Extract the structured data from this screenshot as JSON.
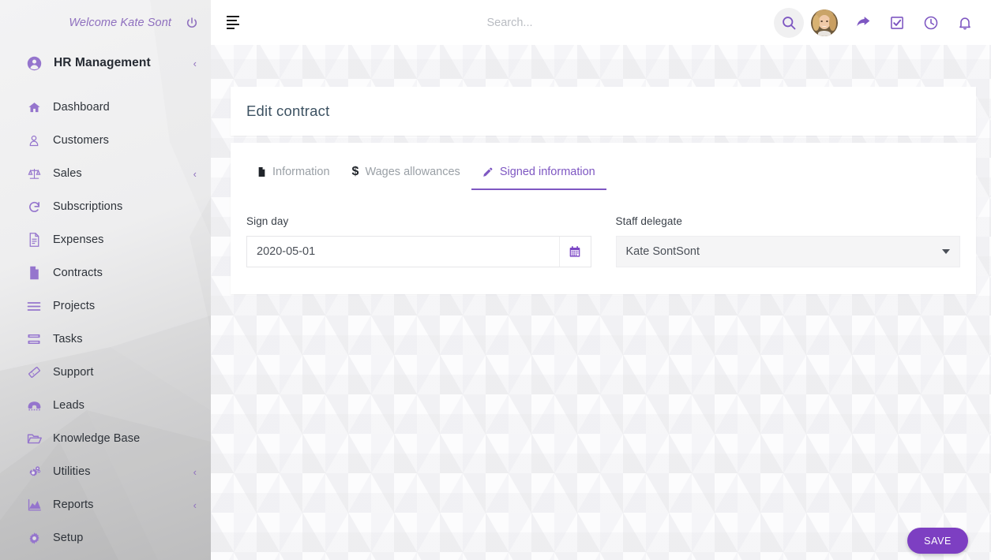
{
  "sidebar": {
    "welcome_text": "Welcome Kate Sont",
    "power_icon": "power-icon",
    "brand": {
      "label": "HR Management",
      "icon": "user-circle-icon",
      "chevron": "‹"
    },
    "items": [
      {
        "label": "Dashboard",
        "icon": "home-icon",
        "chevron": ""
      },
      {
        "label": "Customers",
        "icon": "user-icon",
        "chevron": ""
      },
      {
        "label": "Sales",
        "icon": "scales-icon",
        "chevron": "‹"
      },
      {
        "label": "Subscriptions",
        "icon": "refresh-icon",
        "chevron": ""
      },
      {
        "label": "Expenses",
        "icon": "file-lines-icon",
        "chevron": ""
      },
      {
        "label": "Contracts",
        "icon": "file-icon",
        "chevron": ""
      },
      {
        "label": "Projects",
        "icon": "list-icon",
        "chevron": ""
      },
      {
        "label": "Tasks",
        "icon": "tasks-icon",
        "chevron": ""
      },
      {
        "label": "Support",
        "icon": "ticket-icon",
        "chevron": ""
      },
      {
        "label": "Leads",
        "icon": "phone-icon",
        "chevron": ""
      },
      {
        "label": "Knowledge Base",
        "icon": "folder-open-icon",
        "chevron": ""
      },
      {
        "label": "Utilities",
        "icon": "gears-icon",
        "chevron": "‹"
      },
      {
        "label": "Reports",
        "icon": "chart-area-icon",
        "chevron": "‹"
      },
      {
        "label": "Setup",
        "icon": "gear-icon",
        "chevron": ""
      }
    ]
  },
  "topbar": {
    "menu_icon": "align-left-icon",
    "search_placeholder": "Search...",
    "search_value": "",
    "icons": [
      {
        "name": "search-icon"
      },
      {
        "name": "avatar"
      },
      {
        "name": "share-icon"
      },
      {
        "name": "check-square-icon"
      },
      {
        "name": "clock-icon"
      },
      {
        "name": "bell-icon"
      }
    ]
  },
  "page": {
    "title": "Edit contract",
    "tabs": [
      {
        "label": "Information",
        "icon": "file-icon",
        "active": false
      },
      {
        "label": "Wages allowances",
        "icon": "dollar-icon",
        "active": false
      },
      {
        "label": "Signed information",
        "icon": "pencil-icon",
        "active": true
      }
    ],
    "fields": {
      "sign_day": {
        "label": "Sign day",
        "value": "2020-05-01",
        "icon": "calendar-icon"
      },
      "staff_delegate": {
        "label": "Staff delegate",
        "value": "Kate SontSont",
        "icon": "chevron-down-icon"
      }
    },
    "save_label": "SAVE"
  },
  "colors": {
    "accent": "#7e57c2",
    "save_button": "#7d3fc2",
    "sidebar_icon": "#9575cd",
    "title_text": "#3d5262"
  }
}
